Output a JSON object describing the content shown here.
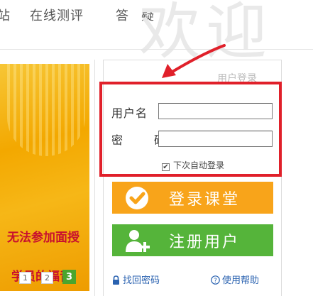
{
  "nav": {
    "home_partial": "站",
    "test": "在线测评",
    "qa": "答疑"
  },
  "background_text": "欢迎",
  "banner": {
    "line1": "无法参加面授",
    "line2": "学员的福音!",
    "pages": [
      "1",
      "2",
      "3"
    ],
    "active_page": 3
  },
  "login": {
    "title": "用户登录",
    "username_label": "用户名",
    "password_label": "密　码",
    "username_value": "",
    "password_value": "",
    "remember_label": "下次自动登录",
    "remember_checked": true,
    "login_button": "登录课堂",
    "register_button": "注册用户",
    "forgot_link": "找回密码",
    "help_link": "使用帮助"
  },
  "colors": {
    "login_button": "#f8a41a",
    "register_button": "#55b43a",
    "highlight": "#e0202a",
    "link": "#2a62b0"
  }
}
